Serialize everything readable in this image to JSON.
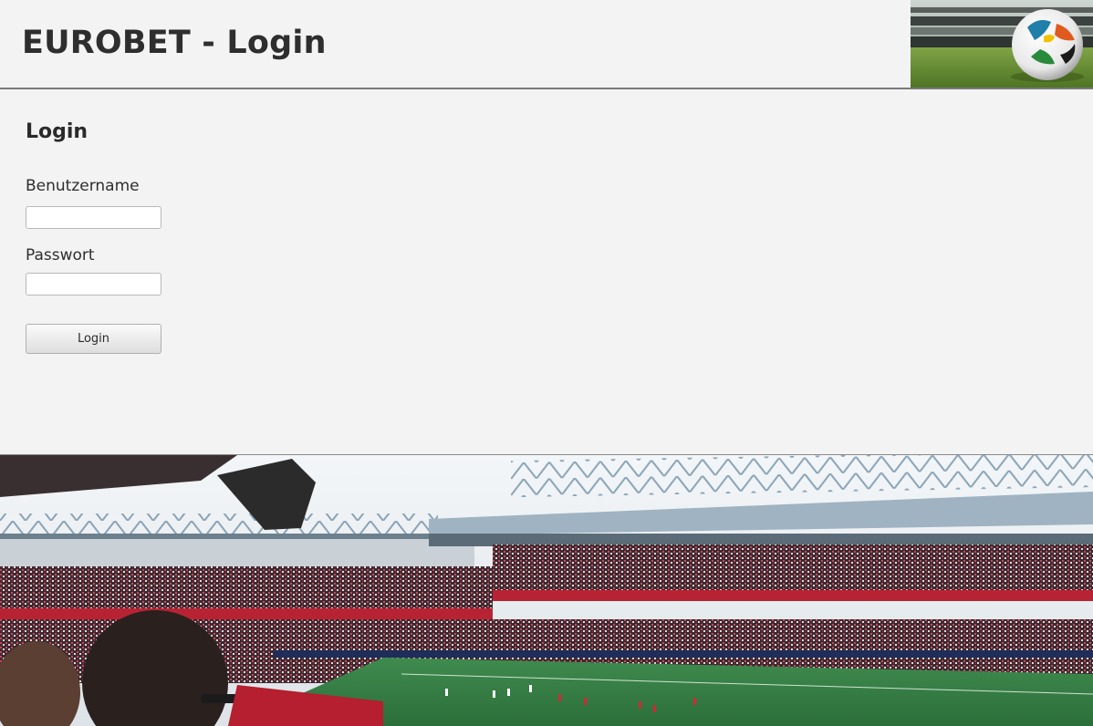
{
  "app": {
    "title": "EUROBET - Login"
  },
  "login": {
    "heading": "Login",
    "username_label": "Benutzername",
    "username_value": "",
    "password_label": "Passwort",
    "password_value": "",
    "submit_label": "Login"
  },
  "colors": {
    "background": "#f3f3f3",
    "header_border": "#7a7a7a",
    "text": "#2a2a2a"
  },
  "images": {
    "header_image": "soccer-ball-on-grass-photo",
    "footer_image": "football-stadium-crowd-photo"
  }
}
